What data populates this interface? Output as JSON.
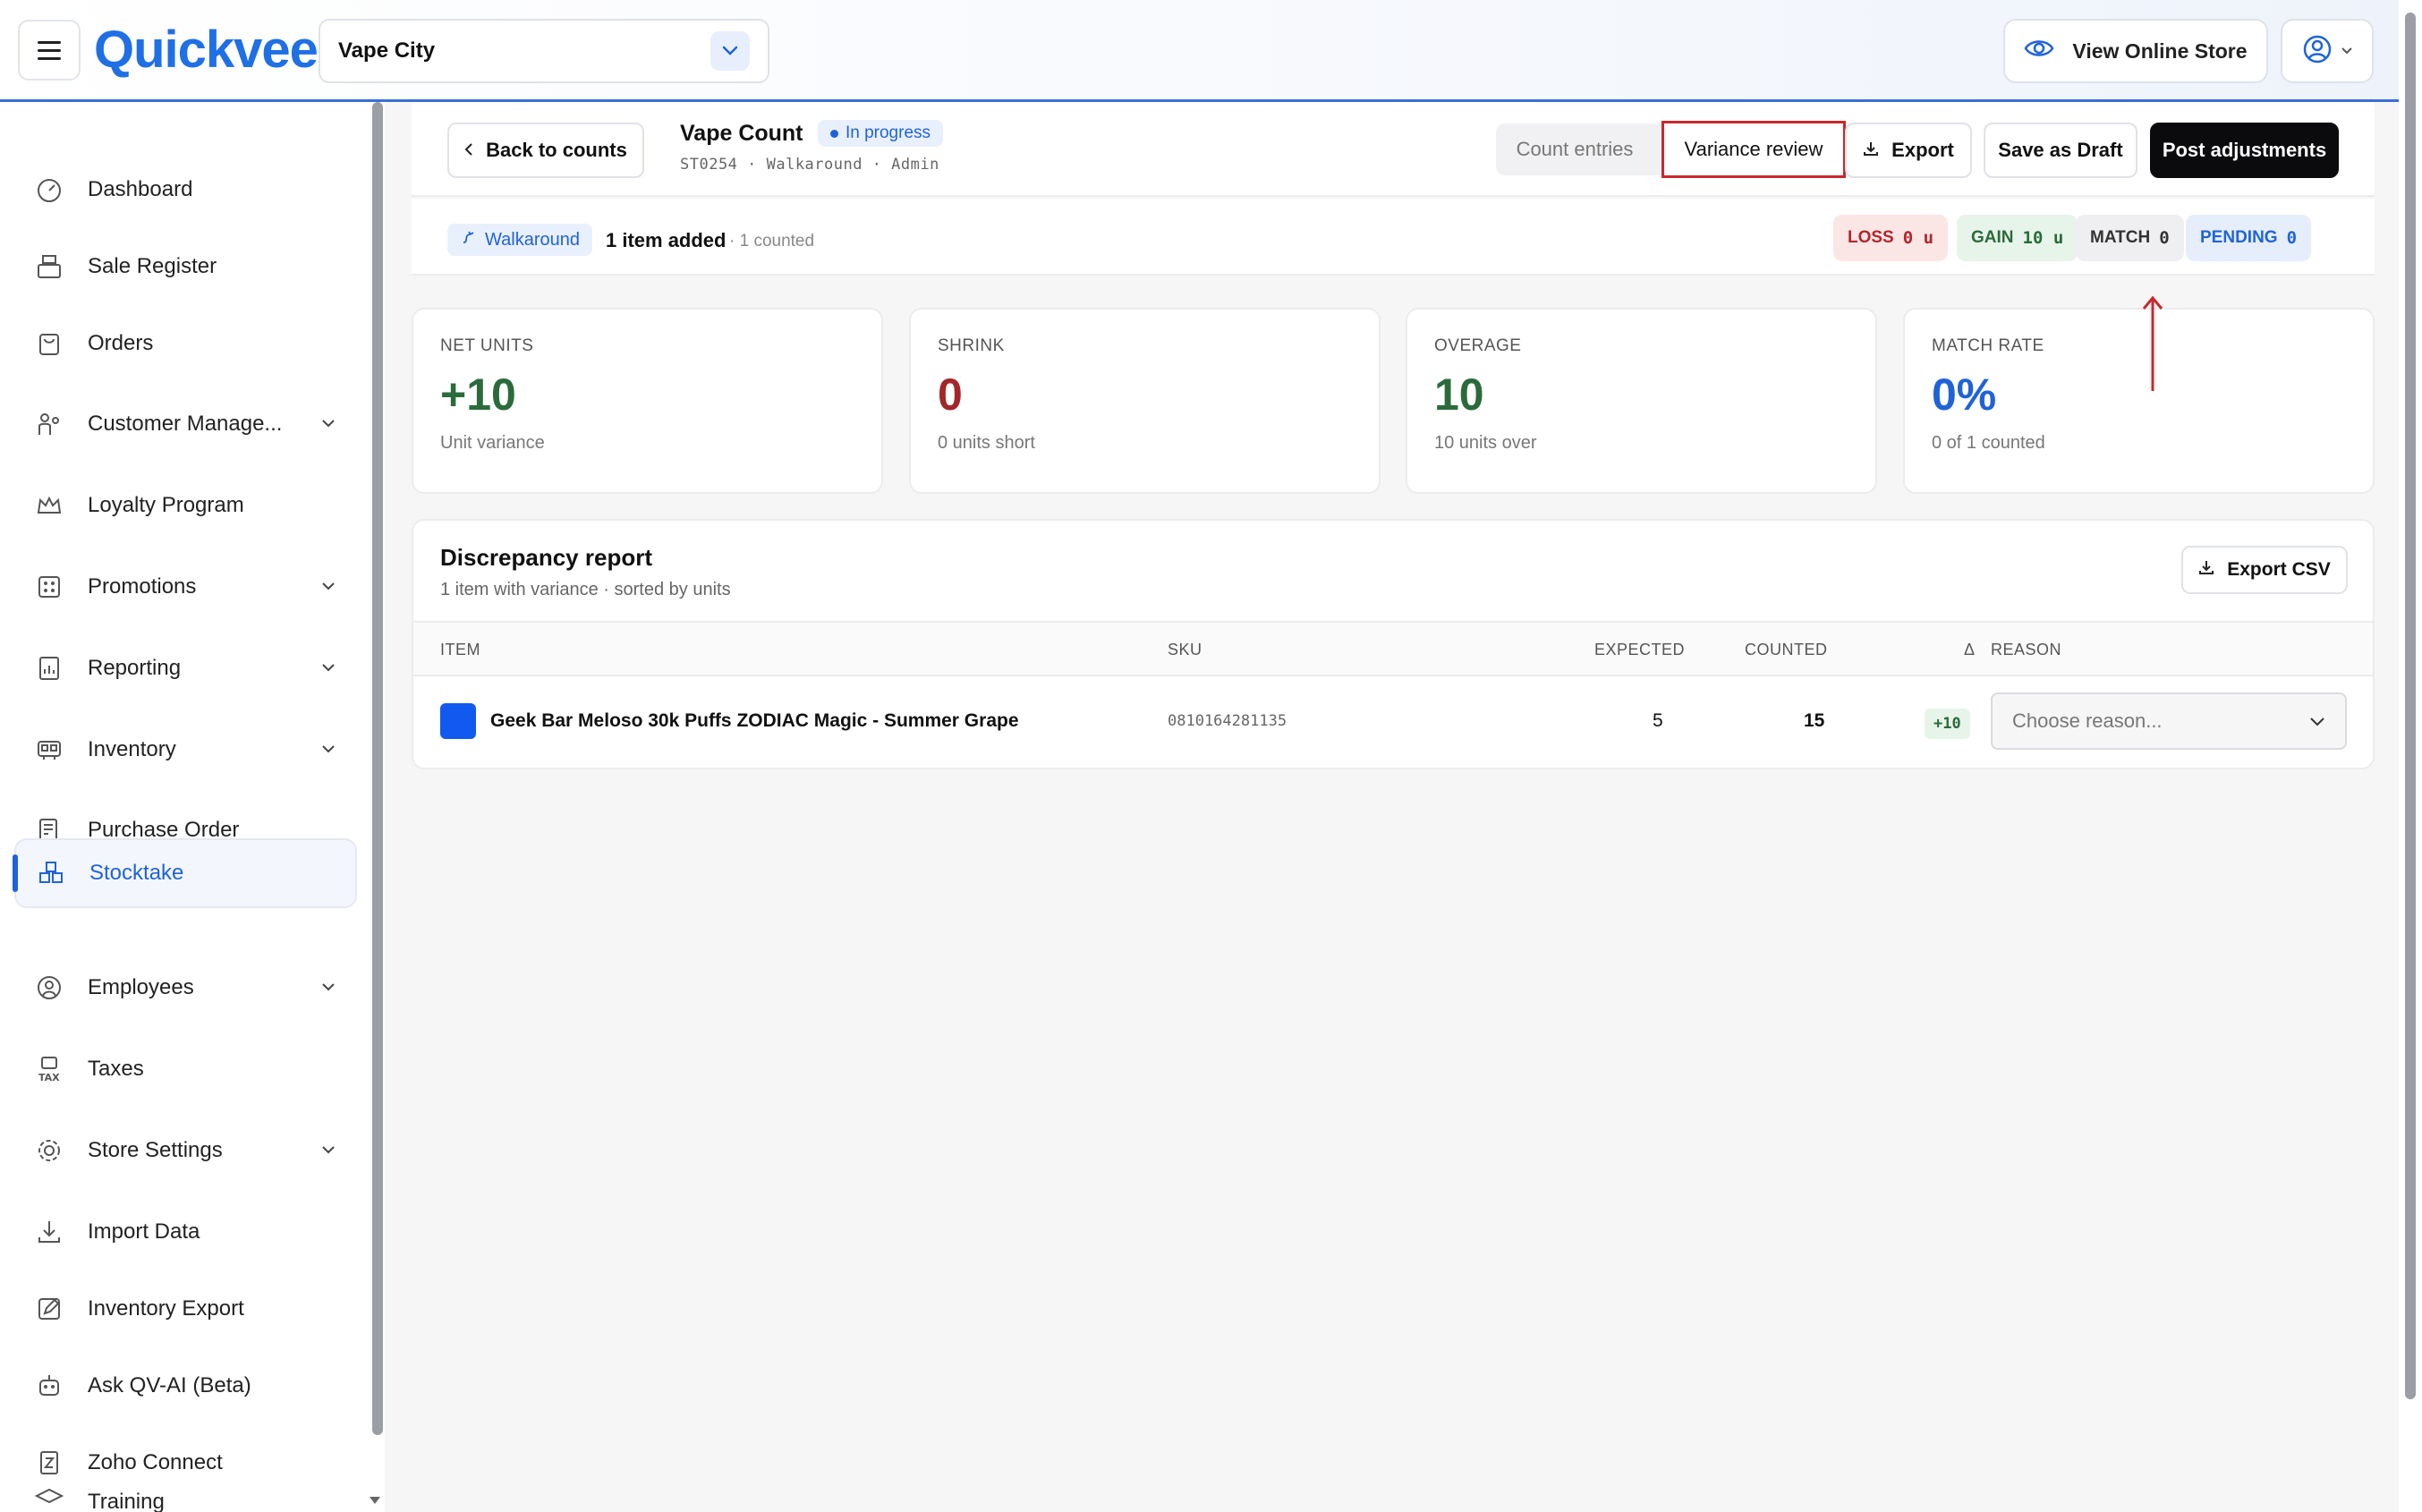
{
  "header": {
    "logo": "Quickvee",
    "store": "Vape City",
    "view_store": "View Online Store"
  },
  "sidebar": {
    "items": [
      {
        "label": "Dashboard",
        "icon": "gauge-icon",
        "expandable": false
      },
      {
        "label": "Sale Register",
        "icon": "register-icon",
        "expandable": false
      },
      {
        "label": "Orders",
        "icon": "bag-icon",
        "expandable": false
      },
      {
        "label": "Customer Manage...",
        "icon": "customers-icon",
        "expandable": true
      },
      {
        "label": "Loyalty Program",
        "icon": "crown-icon",
        "expandable": false
      },
      {
        "label": "Promotions",
        "icon": "promotions-icon",
        "expandable": true
      },
      {
        "label": "Reporting",
        "icon": "report-icon",
        "expandable": true
      },
      {
        "label": "Inventory",
        "icon": "inventory-icon",
        "expandable": true
      },
      {
        "label": "Purchase Order",
        "icon": "purchase-order-icon",
        "expandable": false
      },
      {
        "label": "Stocktake",
        "icon": "stocktake-icon",
        "expandable": false,
        "active": true
      },
      {
        "label": "Employees",
        "icon": "employee-icon",
        "expandable": true
      },
      {
        "label": "Taxes",
        "icon": "tax-icon",
        "expandable": false
      },
      {
        "label": "Store Settings",
        "icon": "gear-icon",
        "expandable": true
      },
      {
        "label": "Import Data",
        "icon": "download-icon",
        "expandable": false
      },
      {
        "label": "Inventory Export",
        "icon": "export-edit-icon",
        "expandable": false
      },
      {
        "label": "Ask QV-AI (Beta)",
        "icon": "robot-icon",
        "expandable": false
      },
      {
        "label": "Zoho Connect",
        "icon": "zoho-icon",
        "expandable": false
      },
      {
        "label": "Training",
        "icon": "graduation-cap-icon",
        "expandable": false
      }
    ]
  },
  "toolbar": {
    "back_label": "Back to counts",
    "title": "Vape Count",
    "status": "In progress",
    "subtitle": "ST0254 · Walkaround · Admin",
    "tab_count_entries": "Count entries",
    "tab_variance_review": "Variance review",
    "export_label": "Export",
    "save_draft_label": "Save as Draft",
    "post_label": "Post adjustments"
  },
  "status": {
    "mode": "Walkaround",
    "items_added": "1 item added",
    "counted": "· 1 counted",
    "loss_label": "LOSS",
    "loss_value": "0 u",
    "gain_label": "GAIN",
    "gain_value": "10 u",
    "match_label": "MATCH",
    "match_value": "0",
    "pending_label": "PENDING",
    "pending_value": "0"
  },
  "cards": [
    {
      "key": "NET UNITS",
      "value": "+10",
      "desc": "Unit variance",
      "color": "#2b6b3b"
    },
    {
      "key": "SHRINK",
      "value": "0",
      "desc": "0 units short",
      "color": "#a3262a"
    },
    {
      "key": "OVERAGE",
      "value": "10",
      "desc": "10 units over",
      "color": "#2b6b3b"
    },
    {
      "key": "MATCH RATE",
      "value": "0%",
      "desc": "0 of 1 counted",
      "color": "#1f63d9"
    }
  ],
  "report": {
    "title": "Discrepancy report",
    "subtitle": "1 item with variance · sorted by units",
    "export_csv": "Export CSV",
    "columns": {
      "item": "ITEM",
      "sku": "SKU",
      "expected": "EXPECTED",
      "counted": "COUNTED",
      "delta": "Δ",
      "reason": "REASON"
    },
    "rows": [
      {
        "item": "Geek Bar Meloso 30k Puffs ZODIAC Magic - Summer Grape",
        "sku": "0810164281135",
        "expected": "5",
        "counted": "15",
        "delta": "+10",
        "reason_placeholder": "Choose reason..."
      }
    ]
  },
  "colors": {
    "accent": "#1f63d9",
    "highlight": "#c8292d",
    "gain": "#2b6b3b",
    "loss": "#a3262a"
  }
}
